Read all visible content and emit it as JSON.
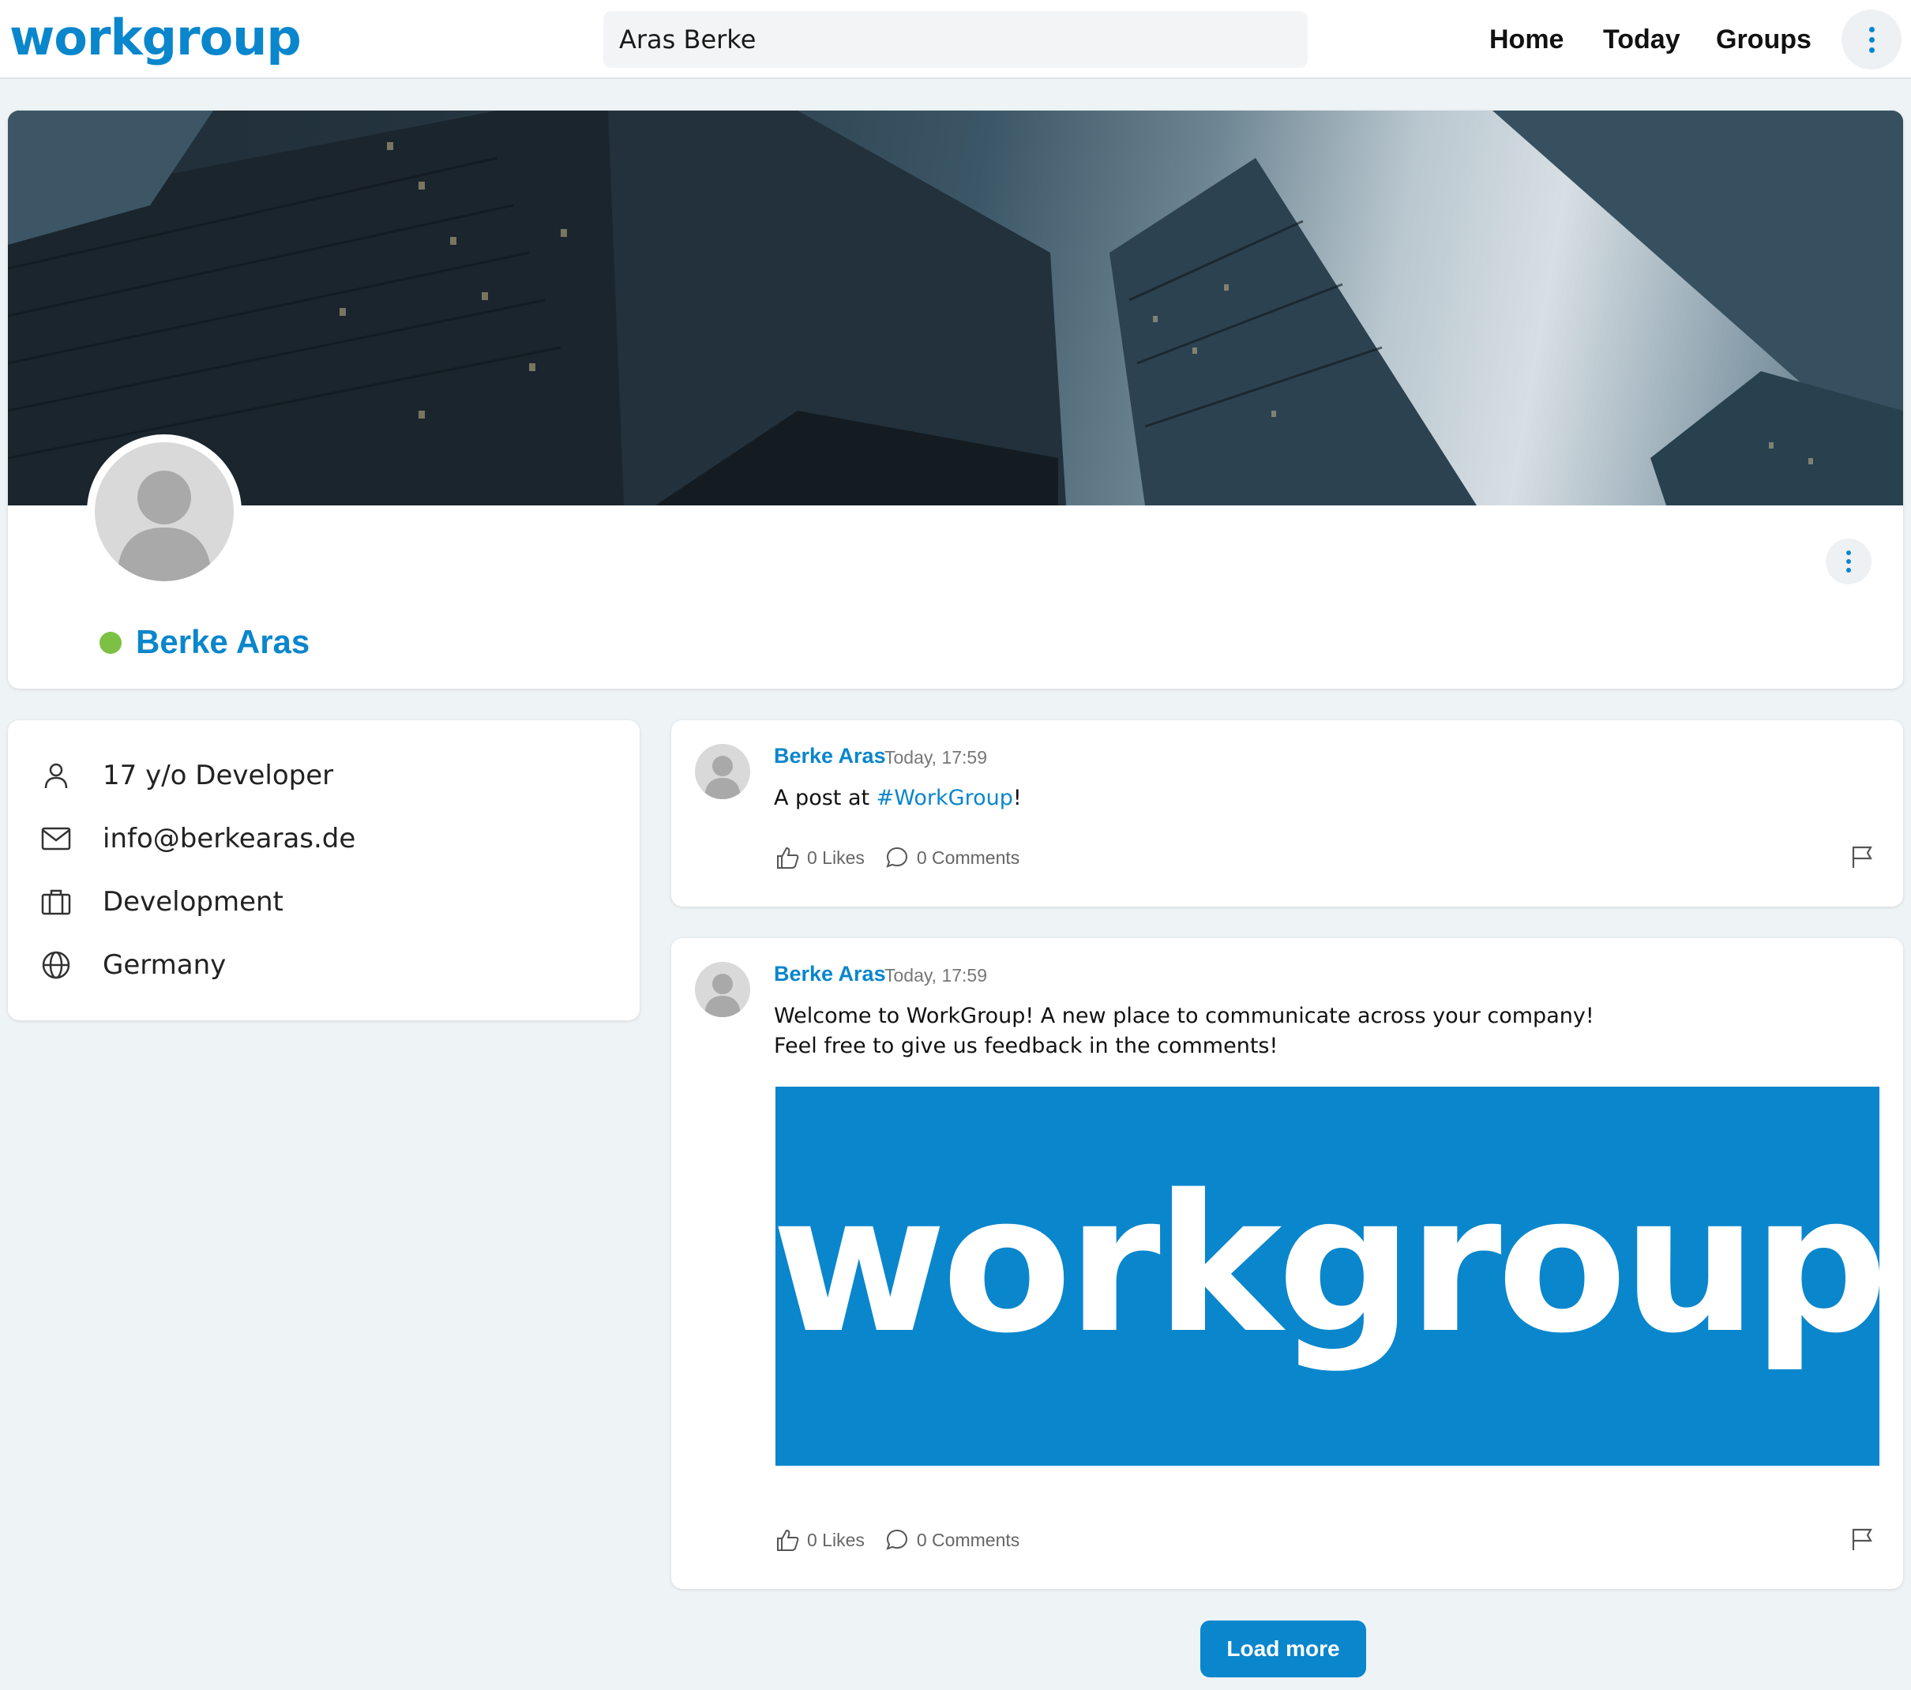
{
  "header": {
    "logo": "workgroup",
    "search_value": "Aras Berke",
    "nav": [
      "Home",
      "Today",
      "Groups"
    ]
  },
  "profile": {
    "name": "Berke Aras",
    "status": "online",
    "status_color": "#7cc143",
    "info": [
      {
        "icon": "person-icon",
        "text": "17 y/o Developer"
      },
      {
        "icon": "mail-icon",
        "text": "info@berkearas.de"
      },
      {
        "icon": "briefcase-icon",
        "text": "Development"
      },
      {
        "icon": "globe-icon",
        "text": "Germany"
      }
    ]
  },
  "posts": [
    {
      "author": "Berke Aras",
      "time": "Today, 17:59",
      "text_before": "A post at ",
      "hashtag": "#WorkGroup",
      "text_after": "!",
      "likes": "0 Likes",
      "comments": "0 Comments"
    },
    {
      "author": "Berke Aras",
      "time": "Today, 17:59",
      "line1": "Welcome to WorkGroup! A new place to communicate across your company!",
      "line2": "Feel free to give us feedback in the comments!",
      "image_text": "workgroup",
      "likes": "0 Likes",
      "comments": "0 Comments"
    }
  ],
  "load_more": "Load more",
  "colors": {
    "accent": "#0a86cc",
    "background": "#eef3f6",
    "card": "#ffffff"
  }
}
